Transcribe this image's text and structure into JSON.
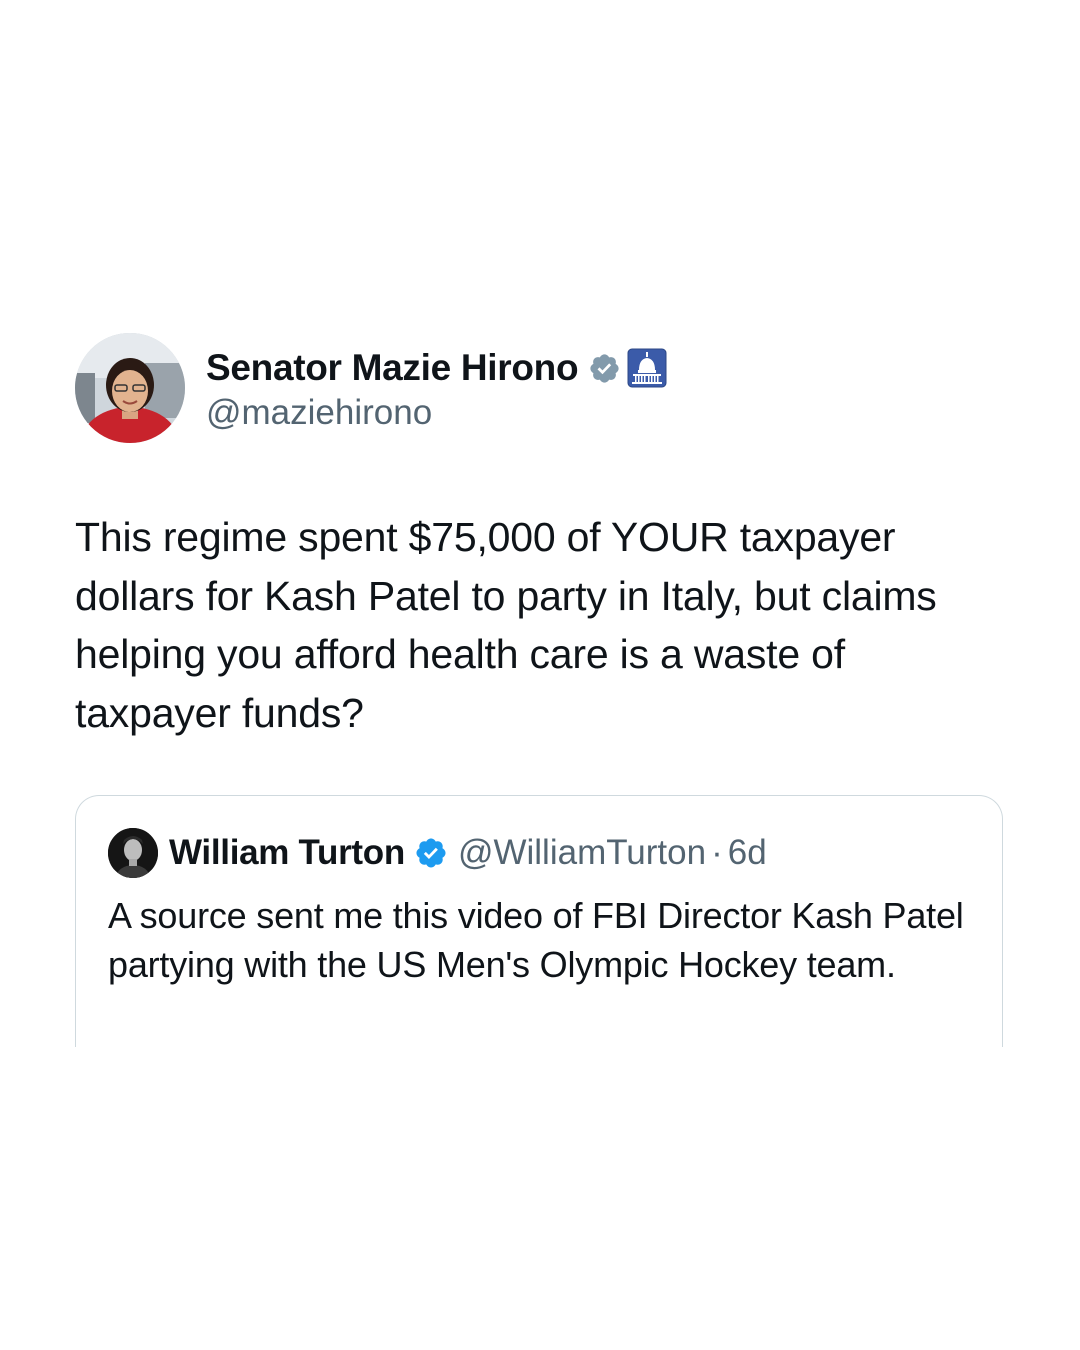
{
  "tweet": {
    "author": {
      "display_name": "Senator Mazie Hirono",
      "handle": "@maziehirono",
      "verified_badge_icon": "verified-gray-check-icon",
      "affiliation_icon": "capitol-dome-icon"
    },
    "text": "This regime spent $75,000 of YOUR taxpayer dollars for Kash Patel to party in Italy, but claims helping you afford health care is a waste of taxpayer funds?"
  },
  "quoted_tweet": {
    "author": {
      "display_name": "William Turton",
      "handle": "@WilliamTurton",
      "verified_badge_icon": "verified-blue-check-icon"
    },
    "separator": "·",
    "time": "6d",
    "text": "A source sent me this video of FBI Director Kash Patel partying with the US Men's Olympic Hockey team."
  },
  "colors": {
    "text_primary": "#0f1419",
    "text_secondary": "#536471",
    "verified_blue": "#1d9bf0",
    "verified_gray": "#829aab",
    "border": "#cfd9de",
    "gov_badge_blue": "#3b5ba9"
  }
}
